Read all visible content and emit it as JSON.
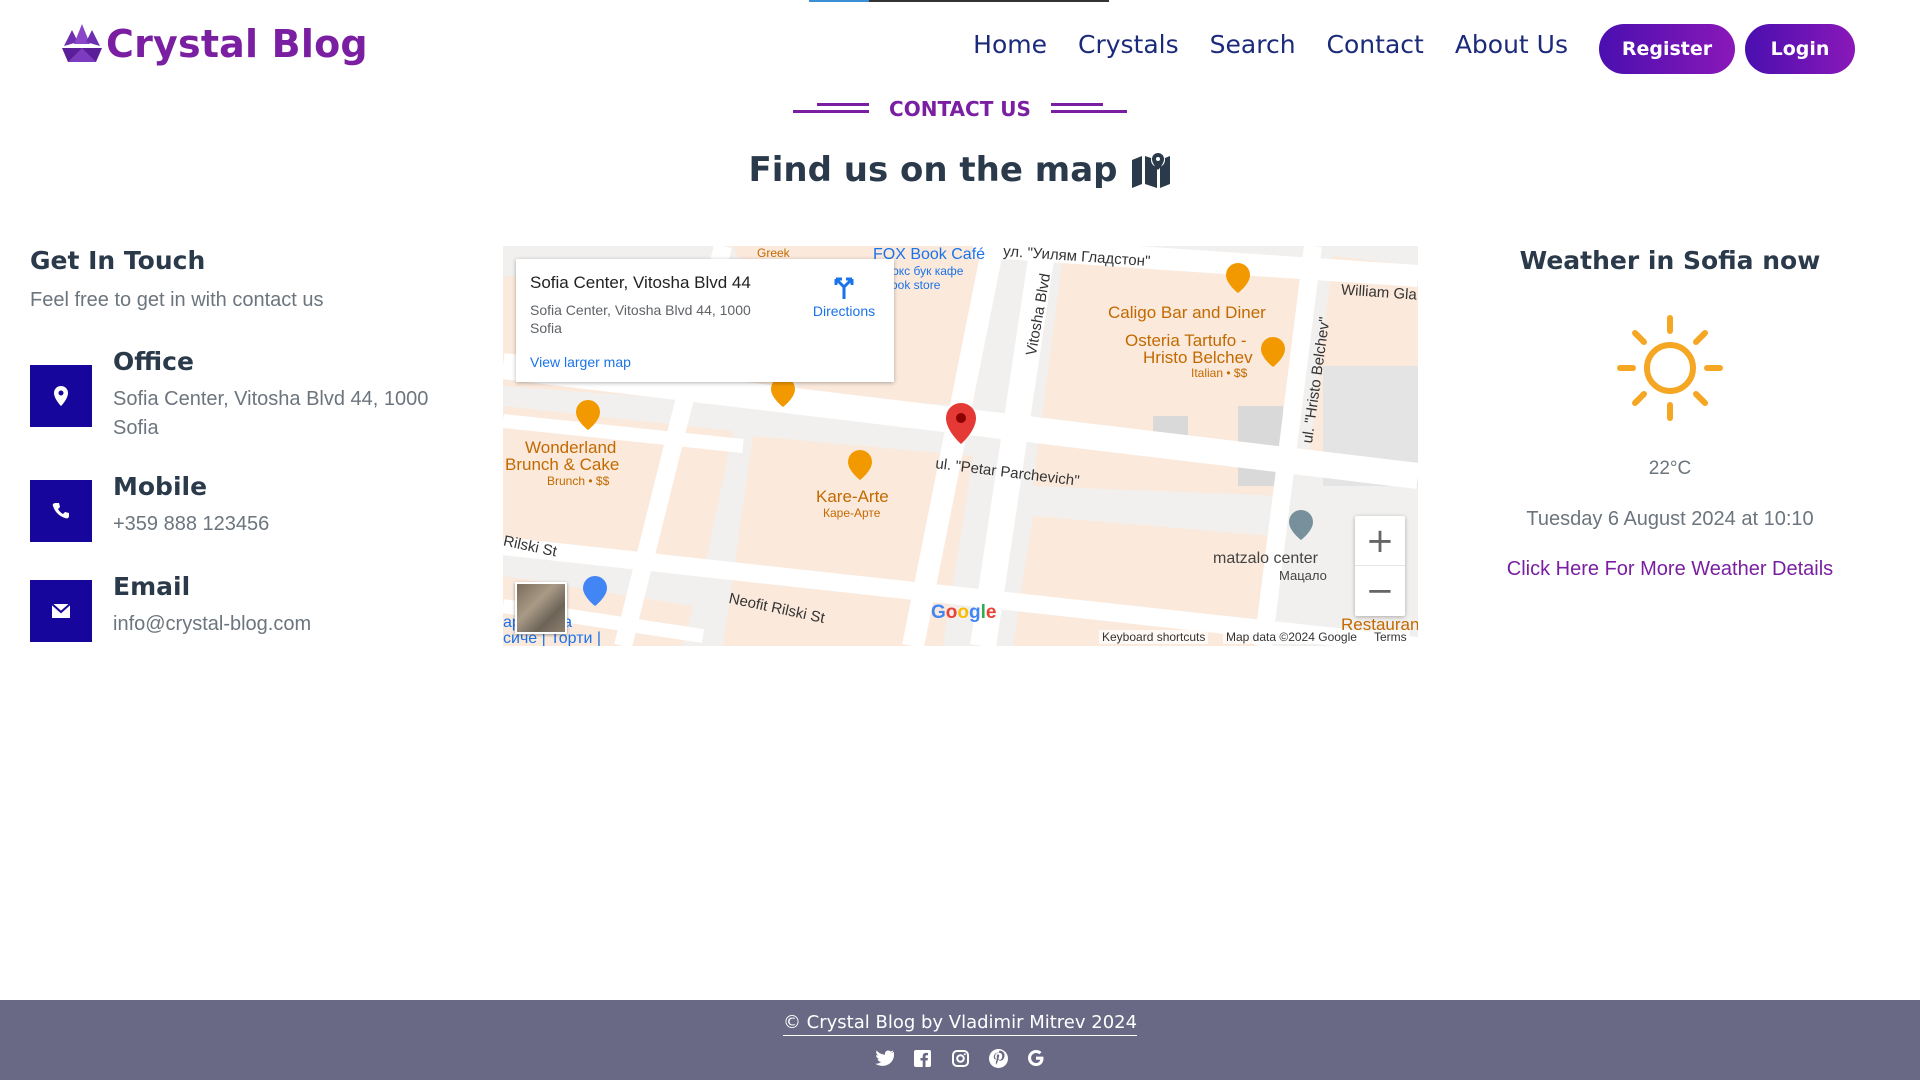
{
  "header": {
    "logo_text": "Crystal Blog",
    "nav": [
      "Home",
      "Crystals",
      "Search",
      "Contact",
      "About Us"
    ],
    "register_label": "Register",
    "login_label": "Login"
  },
  "section": {
    "kicker": "CONTACT US",
    "title": "Find us on the map"
  },
  "contact": {
    "title": "Get In Touch",
    "subtitle": "Feel free to get in with contact us",
    "items": [
      {
        "label": "Office",
        "value": "Sofia Center, Vitosha Blvd 44, 1000 Sofia",
        "icon": "location-pin-icon"
      },
      {
        "label": "Mobile",
        "value": "+359 888 123456",
        "icon": "phone-icon"
      },
      {
        "label": "Email",
        "value": "info@crystal-blog.com",
        "icon": "envelope-icon"
      }
    ]
  },
  "map": {
    "card_title": "Sofia Center, Vitosha Blvd 44",
    "card_address": "Sofia Center, Vitosha Blvd 44, 1000 Sofia",
    "view_larger": "View larger map",
    "directions": "Directions",
    "labels": {
      "greek": "Greek",
      "fox_book": "FOX Book Café",
      "fox_book_cyr": "Фокс бук кафе",
      "book_store": "Book store",
      "gladston": "ул. \"Уилям Гладстон\"",
      "william": "William Gla",
      "caligo": "Caligo Bar and Diner",
      "osteria_1": "Osteria Tartufo -",
      "osteria_2": "Hristo Belchev",
      "osteria_sub": "Italian • $$",
      "vitosha": "Vitosha Blvd",
      "hristo_belchev": "ul. \"Hristo Belchev\"",
      "wonderland_1": "Wonderland",
      "wonderland_2": "Brunch & Cake",
      "wonderland_sub": "Brunch • $$",
      "kare_1": "Kare-Arte",
      "kare_2": "Каре-Арте",
      "petar": "ul. \"Petar Parchevich\"",
      "rilski": "Rilski St",
      "neofit": "Neofit Rilski St",
      "matzalo_1": "matzalo center",
      "matzalo_2": "Мацало",
      "vila_1": "ара Вила",
      "vila_2": "сиче | Торти |",
      "restaurant": "Restaurant"
    },
    "google_logo": "Google",
    "footer_items": [
      "Keyboard shortcuts",
      "Map data ©2024 Google",
      "Terms"
    ],
    "zoom_in": "+",
    "zoom_out": "−"
  },
  "weather": {
    "title": "Weather in Sofia now",
    "icon": "sun-icon",
    "temperature": "22°C",
    "datetime": "Tuesday 6 August 2024 at 10:10",
    "link": "Click Here For More Weather Details"
  },
  "footer": {
    "copyright": "© Crystal Blog by Vladimir Mitrev 2024",
    "social": [
      "twitter-icon",
      "facebook-icon",
      "instagram-icon",
      "pinterest-icon",
      "google-icon"
    ]
  },
  "colors": {
    "brand": "#7a1fa2",
    "nav": "#1c2a7a",
    "icon_box": "#16069b",
    "footer": "#696986"
  }
}
